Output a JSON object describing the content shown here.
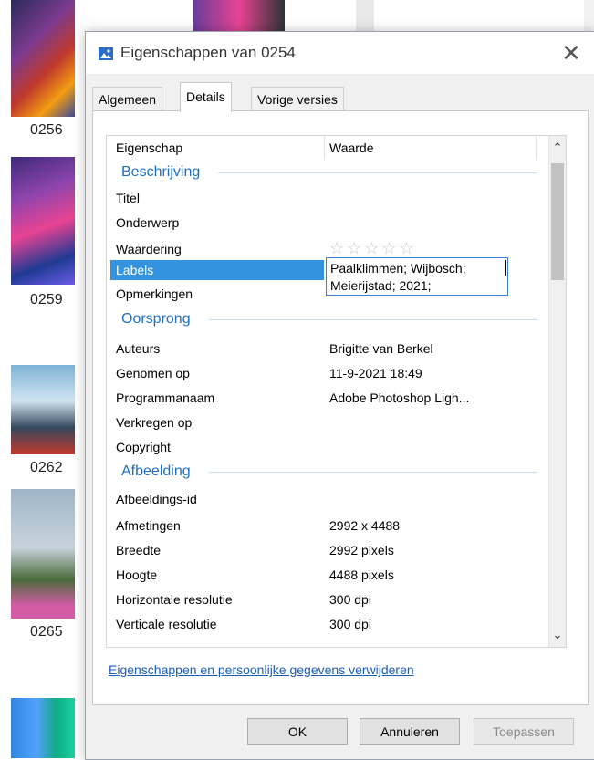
{
  "background": {
    "thumb_labels": [
      "0256",
      "0259",
      "0262",
      "0265"
    ]
  },
  "dialog": {
    "title": "Eigenschappen van 0254",
    "close_glyph": "✕",
    "tabs": [
      {
        "label": "Algemeen",
        "active": false
      },
      {
        "label": "Details",
        "active": true
      },
      {
        "label": "Vorige versies",
        "active": false
      }
    ],
    "columns": {
      "property": "Eigenschap",
      "value": "Waarde"
    },
    "groups": {
      "description": "Beschrijving",
      "origin": "Oorsprong",
      "image": "Afbeelding"
    },
    "rows": {
      "title": {
        "label": "Titel",
        "value": ""
      },
      "subject": {
        "label": "Onderwerp",
        "value": ""
      },
      "rating": {
        "label": "Waardering",
        "value": "☆☆☆☆☆"
      },
      "labels": {
        "label": "Labels",
        "value_line1": "Paalklimmen; Wijbosch;",
        "value_line2": "Meierijstad; 2021;"
      },
      "comments": {
        "label": "Opmerkingen",
        "value": ""
      },
      "authors": {
        "label": "Auteurs",
        "value": "Brigitte van Berkel"
      },
      "taken": {
        "label": "Genomen op",
        "value": "11-9-2021 18:49"
      },
      "program": {
        "label": "Programmanaam",
        "value": "Adobe Photoshop Ligh..."
      },
      "acquired": {
        "label": "Verkregen op",
        "value": ""
      },
      "copyright": {
        "label": "Copyright",
        "value": ""
      },
      "image_id": {
        "label": "Afbeeldings-id",
        "value": ""
      },
      "dimensions": {
        "label": "Afmetingen",
        "value": "2992 x 4488"
      },
      "width": {
        "label": "Breedte",
        "value": "2992 pixels"
      },
      "height": {
        "label": "Hoogte",
        "value": "4488 pixels"
      },
      "hres": {
        "label": "Horizontale resolutie",
        "value": "300 dpi"
      },
      "vres": {
        "label": "Verticale resolutie",
        "value": "300 dpi"
      }
    },
    "remove_link": "Eigenschappen en persoonlijke gegevens verwijderen",
    "buttons": {
      "ok": "OK",
      "cancel": "Annuleren",
      "apply": "Toepassen"
    },
    "colors": {
      "accent": "#1d6fc4",
      "selection": "#3393df",
      "link": "#1e5db5"
    }
  }
}
